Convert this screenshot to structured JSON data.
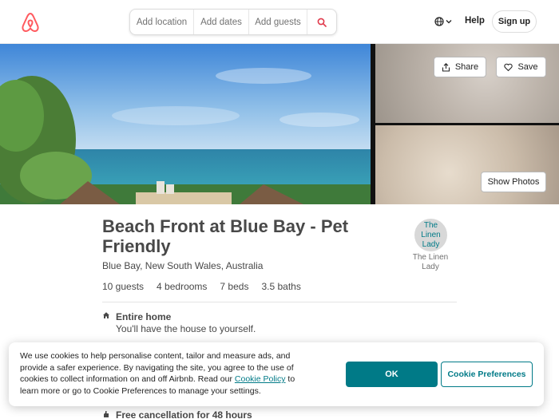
{
  "header": {
    "logo_icon": "airbnb-logo-icon",
    "search": {
      "location_placeholder": "Add location",
      "dates_placeholder": "Add dates",
      "guests_placeholder": "Add guests",
      "search_icon": "search-icon"
    },
    "language_icon": "globe-icon",
    "help_label": "Help",
    "signup_label": "Sign up"
  },
  "photos": {
    "share_label": "Share",
    "save_label": "Save",
    "show_photos_label": "Show Photos"
  },
  "listing": {
    "title": "Beach Front at Blue Bay - Pet Friendly",
    "location": "Blue Bay, New South Wales, Australia",
    "stats": [
      "10 guests",
      "4 bedrooms",
      "7 beds",
      "3.5 baths"
    ],
    "host": {
      "avatar_text": "The Linen Lady",
      "name": "The Linen Lady"
    },
    "features": [
      {
        "icon": "home-icon",
        "title": "Entire home",
        "desc": "You'll have the house to yourself."
      },
      {
        "icon": "hand-icon",
        "title": "Free cancellation for 48 hours"
      }
    ]
  },
  "cookie_banner": {
    "text_before_link": "We use cookies to help personalise content, tailor and measure ads, and provide a safer experience. By navigating the site, you agree to the use of cookies to collect information on and off Airbnb. Read our ",
    "link_label": "Cookie Policy",
    "text_after_link": " to learn more or go to Cookie Preferences to manage your settings.",
    "ok_label": "OK",
    "preferences_label": "Cookie Preferences"
  },
  "colors": {
    "brand": "#ff5a5f",
    "accent": "#007a87",
    "search_icon": "#e0384a"
  }
}
